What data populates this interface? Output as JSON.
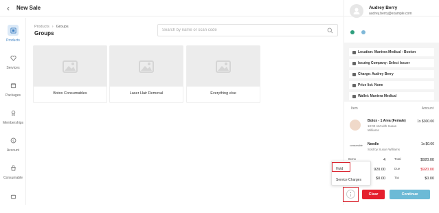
{
  "header": {
    "title": "New Sale",
    "back_icon": "chevron-left-icon"
  },
  "sidebar": {
    "items": [
      {
        "label": "Products",
        "icon": "products-icon",
        "active": true
      },
      {
        "label": "Services",
        "icon": "services-icon",
        "active": false
      },
      {
        "label": "Packages",
        "icon": "packages-icon",
        "active": false
      },
      {
        "label": "Memberships",
        "icon": "memberships-icon",
        "active": false
      },
      {
        "label": "Account",
        "icon": "account-icon",
        "active": false
      },
      {
        "label": "Consumable",
        "icon": "consumable-icon",
        "active": false
      }
    ]
  },
  "main": {
    "breadcrumb": [
      "Products",
      "Groups"
    ],
    "heading": "Groups",
    "search_placeholder": "Search by name or scan code",
    "groups": [
      {
        "label": "Botox Consumables"
      },
      {
        "label": "Laser Hair Removal"
      },
      {
        "label": "Everything else"
      }
    ]
  },
  "customer": {
    "name": "Audrey Berry",
    "email": "audrey.berry@example.com"
  },
  "info": [
    {
      "label": "Location: Maniera Medical - Boston",
      "icon": "location-icon"
    },
    {
      "label": "Issuing Company: Select Issuer",
      "icon": "building-icon"
    },
    {
      "label": "Charge: Audrey Berry",
      "icon": "card-icon"
    },
    {
      "label": "Price list: None",
      "icon": "tag-icon"
    },
    {
      "label": "Wallet: Maniera Medical",
      "icon": "wallet-icon"
    }
  ],
  "cart": {
    "col_item": "Item",
    "col_amount": "Amount",
    "items": [
      {
        "name": "Botox - 1 Area (Female)",
        "sub": "10:00 AM with Susan Williams",
        "price": "1x $300.00"
      },
      {
        "name": "Needle",
        "sub": "Sold by Susan Williams",
        "price": "1x $0.00",
        "logo_text": "consumable"
      }
    ]
  },
  "summary": {
    "items_label": "Items",
    "items_value": "4",
    "left_value_2": "920.00",
    "left_value_3": "$0.00",
    "total_label": "Total",
    "total_value": "$920.00",
    "due_label": "Due",
    "due_value": "$920.00",
    "tax_label": "Tax",
    "tax_value": "$0.00"
  },
  "menu": {
    "items": [
      {
        "label": "Hold"
      },
      {
        "label": "Service Charges"
      }
    ]
  },
  "actions": {
    "more_label": "⋮",
    "clear_label": "Clear",
    "continue_label": "Continue"
  },
  "colors": {
    "accent": "#3c7fc2",
    "clear": "#e51f2d",
    "continue": "#6cbad6",
    "highlight": "#d9232e"
  }
}
